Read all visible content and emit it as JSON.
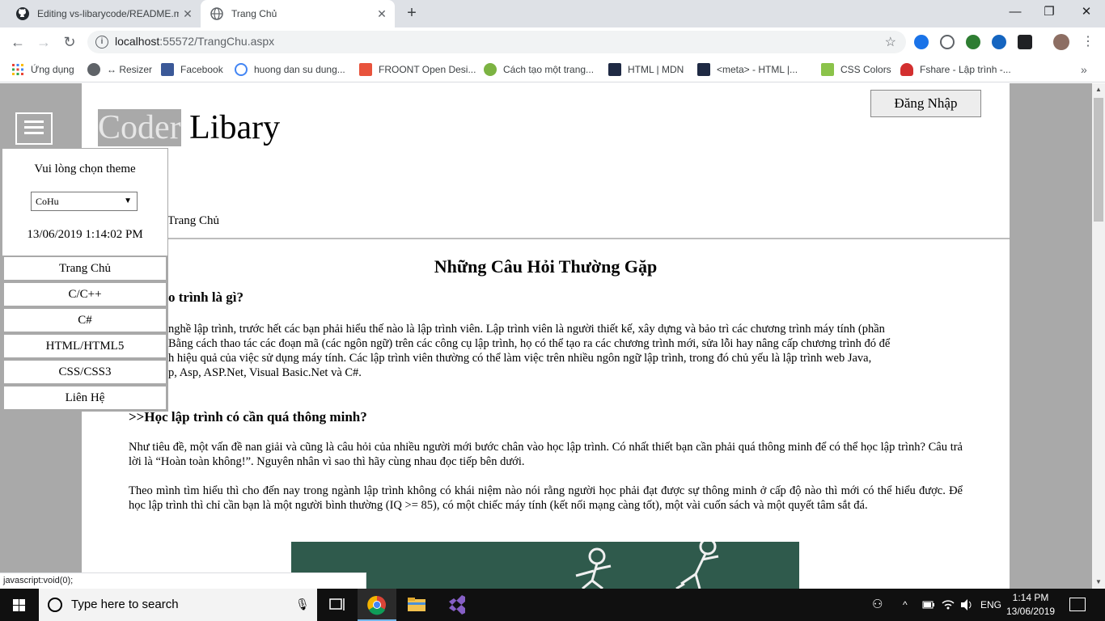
{
  "browser": {
    "tabs": [
      {
        "title": "Editing vs-libarycode/README.m",
        "close": "✕"
      },
      {
        "title": "Trang Chủ",
        "close": "✕"
      }
    ],
    "new_tab": "+",
    "window_controls": {
      "minimize": "—",
      "restore": "❐",
      "close": "✕"
    },
    "nav": {
      "back": "←",
      "forward": "→",
      "reload": "↻"
    },
    "url": {
      "host": "localhost",
      "rest": ":55572/TrangChu.aspx"
    },
    "bookmark_star": "☆",
    "menu": "⋮",
    "bookmarks": [
      {
        "label": "Ứng dụng",
        "color": "#e8453c"
      },
      {
        "label": "↔ Resizer",
        "color": "#5f6368"
      },
      {
        "label": "Facebook",
        "color": "#3b5998"
      },
      {
        "label": "huong dan su dung...",
        "color": "#4285f4"
      },
      {
        "label": "FROONT Open Desi...",
        "color": "#e8533c"
      },
      {
        "label": "Cách tạo một trang...",
        "color": "#7cb342"
      },
      {
        "label": "HTML | MDN",
        "color": "#1f2a44"
      },
      {
        "label": "<meta> - HTML |...",
        "color": "#1f2a44"
      },
      {
        "label": "CSS Colors",
        "color": "#8bc34a"
      },
      {
        "label": "Fshare - Lập trình -...",
        "color": "#d32f2f"
      }
    ],
    "bookmarks_more": "»"
  },
  "page": {
    "logo": {
      "highlight": "Coder",
      "rest": " Libary"
    },
    "login_button": "Đăng Nhập",
    "breadcrumb": "Trang Chủ",
    "faq_title": "Những Câu Hỏi Thường Gặp",
    "q1_visible": "o trình là gì?",
    "p1_lines": [
      "nghề lập trình, trước hết các bạn phải hiểu thế nào là lập trình viên. Lập trình viên là người thiết kế, xây dựng và bảo trì các chương trình máy tính (phần",
      "Bằng cách thao tác các đoạn mã (các ngôn ngữ) trên các công cụ lập trình, họ có thể tạo ra các chương trình mới, sửa lỗi hay nâng cấp chương trình đó để",
      "h hiệu quả của việc sử dụng máy tính. Các lập trình viên thường có thể làm việc trên nhiều ngôn ngữ lập trình, trong đó chủ yếu là lập trình web Java,",
      "p, Asp, ASP.Net, Visual Basic.Net và C#."
    ],
    "q2": ">>Học lập trình có cần quá thông minh?",
    "p2": "Như tiêu đề, một vấn đề nan giải và cũng là câu hỏi của nhiều người mới bước chân vào học lập trình. Có nhất thiết bạn cần phải quá thông minh để có thể học lập trình? Câu trả lời là “Hoàn toàn không!”. Nguyên nhân vì sao thì hãy cùng nhau đọc tiếp bên dưới.",
    "p3": "Theo mình tìm hiểu thì cho đến nay trong ngành lập trình không có khái niệm nào nói rằng người học phải đạt được sự thông minh ở cấp độ nào thì mới có thể hiểu được. Để học lập trình thì chỉ cần bạn là một người bình thường (IQ >= 85), có một chiếc máy tính (kết nối mạng càng tốt), một vài cuốn sách và một quyết tâm sắt đá."
  },
  "sidemenu": {
    "theme_label": "Vui lòng chọn theme",
    "theme_selected": "CoHu",
    "select_arrow": "▼",
    "datetime": "13/06/2019 1:14:02 PM",
    "items": [
      "Trang Chủ",
      "C/C++",
      "C#",
      "HTML/HTML5",
      "CSS/CSS3",
      "Liên Hệ"
    ]
  },
  "scrollbar": {
    "up": "▲",
    "down": "▼"
  },
  "status_text": "javascript:void(0);",
  "taskbar": {
    "search_placeholder": "Type here to search",
    "mic": "🎙",
    "tray": {
      "people": "⚇",
      "chevron": "^",
      "language": "ENG"
    },
    "time": "1:14 PM",
    "date": "13/06/2019"
  }
}
